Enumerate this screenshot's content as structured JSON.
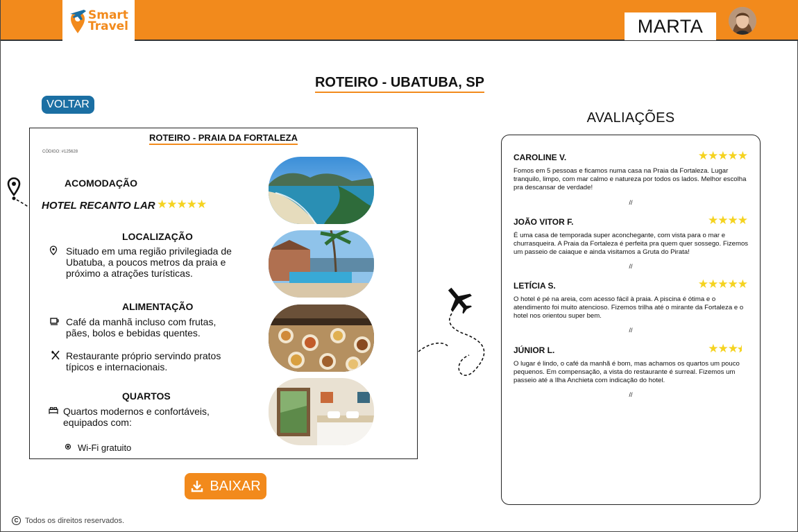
{
  "header": {
    "logo_line1": "Smart",
    "logo_line2": "Travel",
    "user_name": "MARTA"
  },
  "page": {
    "title": "ROTEIRO - UBATUBA, SP",
    "back_label": "VOLTAR",
    "download_label": "BAIXAR"
  },
  "itinerary": {
    "title": "ROTEIRO - PRAIA DA FORTALEZA",
    "code": "CÓDIGO: #125628",
    "accommodation_heading": "ACOMODAÇÃO",
    "hotel_name": "HOTEL RECANTO LAR",
    "hotel_rating": 5,
    "hotel_stars": "★★★★★",
    "location_heading": "LOCALIZAÇÃO",
    "location_text": "Situado em uma região privilegiada de Ubatuba, a poucos metros da praia e próximo a atrações turísticas.",
    "food_heading": "ALIMENTAÇÃO",
    "food_breakfast": "Café da manhã incluso com frutas, pães, bolos e bebidas quentes.",
    "food_restaurant": "Restaurante próprio servindo pratos típicos e internacionais.",
    "rooms_heading": "QUARTOS",
    "rooms_text": "Quartos modernos e confortáveis, equipados com:",
    "amenities": [
      "Wi-Fi gratuito"
    ]
  },
  "reviews": {
    "title": "AVALIAÇÕES",
    "separator": "//",
    "items": [
      {
        "name": "CAROLINE V.",
        "rating": 5,
        "stars": "★★★★★",
        "text": "Fomos em 5 pessoas e ficamos numa casa na Praia da Fortaleza. Lugar tranquilo, limpo, com mar calmo e natureza por todos os lados. Melhor escolha pra descansar de verdade!"
      },
      {
        "name": "JOÃO VITOR F.",
        "rating": 4,
        "stars": "★★★★",
        "text": "É uma casa de temporada super aconchegante, com vista para o mar e churrasqueira. A Praia da Fortaleza é perfeita pra quem quer sossego. Fizemos um passeio de caiaque e ainda visitamos a Gruta do Pirata!"
      },
      {
        "name": "LETÍCIA S.",
        "rating": 5,
        "stars": "★★★★★",
        "text": "O hotel é pé na areia, com acesso fácil à praia. A piscina é ótima e o atendimento foi muito atencioso. Fizemos trilha até o mirante da Fortaleza e o hotel nos orientou super bem."
      },
      {
        "name": "JÚNIOR L.",
        "rating": 3.5,
        "stars": "★★★",
        "text": "O lugar é lindo, o café da manhã é bom, mas achamos os quartos um pouco pequenos. Em compensação, a vista do restaurante é surreal. Fizemos um passeio até a Ilha Anchieta com indicação do hotel."
      }
    ]
  },
  "footer": {
    "copyright_symbol": "C",
    "text": "Todos os direitos reservados."
  },
  "colors": {
    "brand_orange": "#f28a1c",
    "button_blue": "#1b6fa3",
    "star_yellow": "#f5d320"
  }
}
